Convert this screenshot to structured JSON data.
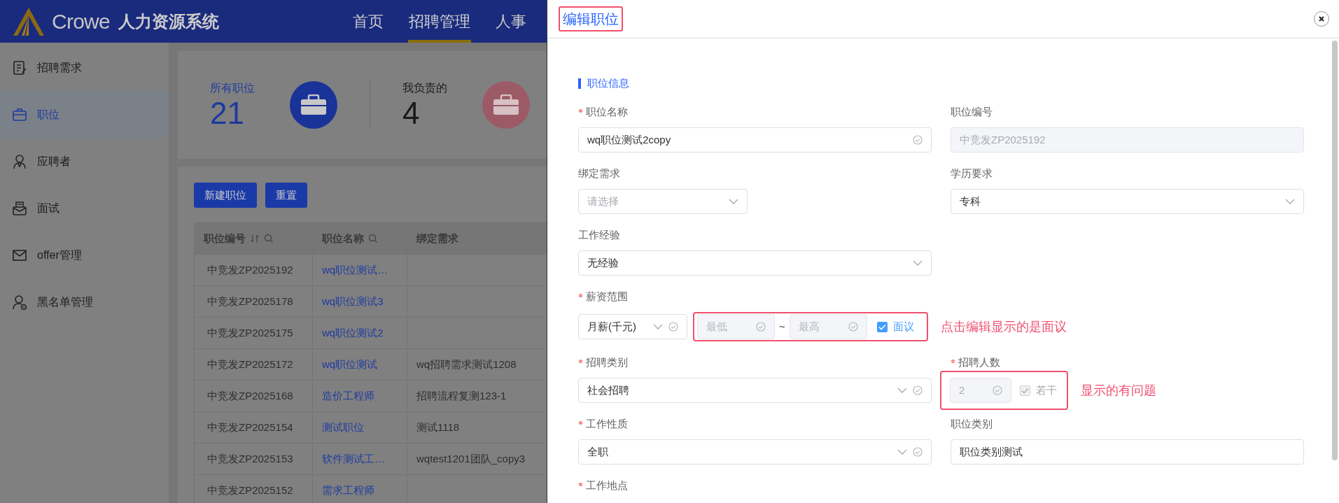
{
  "header": {
    "brand_name": "Crowe",
    "system_name": "人力资源系统",
    "nav": [
      {
        "label": "首页",
        "selected": false
      },
      {
        "label": "招聘管理",
        "selected": true
      },
      {
        "label": "人事",
        "selected": false
      }
    ]
  },
  "sidebar": {
    "items": [
      {
        "label": "招聘需求",
        "selected": false
      },
      {
        "label": "职位",
        "selected": true
      },
      {
        "label": "应聘者",
        "selected": false
      },
      {
        "label": "面试",
        "selected": false
      },
      {
        "label": "offer管理",
        "selected": false
      },
      {
        "label": "黑名单管理",
        "selected": false
      }
    ]
  },
  "stats": [
    {
      "label": "所有职位",
      "value": "21",
      "kind": "primary"
    },
    {
      "label": "我负责的",
      "value": "4",
      "kind": "secondary"
    }
  ],
  "toolbar": {
    "buttons": [
      "新建职位",
      "重置"
    ]
  },
  "table": {
    "columns": [
      {
        "label": "职位编号",
        "sortable": true,
        "searchable": true
      },
      {
        "label": "职位名称",
        "sortable": false,
        "searchable": true
      },
      {
        "label": "绑定需求",
        "sortable": false,
        "searchable": false
      }
    ],
    "rows": [
      [
        "中竞发ZP2025192",
        "wq职位测试…",
        ""
      ],
      [
        "中竞发ZP2025178",
        "wq职位测试3",
        ""
      ],
      [
        "中竞发ZP2025175",
        "wq职位测试2",
        ""
      ],
      [
        "中竞发ZP2025172",
        "wq职位测试",
        "wq招聘需求测试1208"
      ],
      [
        "中竞发ZP2025168",
        "造价工程师",
        "招聘流程复测123-1"
      ],
      [
        "中竞发ZP2025154",
        "测试职位",
        "测试1118"
      ],
      [
        "中竞发ZP2025153",
        "软件测试工…",
        "wqtest1201团队_copy3"
      ],
      [
        "中竞发ZP2025152",
        "需求工程师",
        ""
      ]
    ]
  },
  "drawer": {
    "title": "编辑职位",
    "title_highlighted": true,
    "section_title": "职位信息",
    "rows": [
      [
        {
          "label": "职位名称",
          "required": true,
          "kind": "text",
          "value": "wq职位测试2copy",
          "validated": true,
          "disabled": false
        },
        {
          "label": "职位编号",
          "required": false,
          "kind": "text",
          "value": "中竞发ZP2025192",
          "validated": false,
          "disabled": true
        }
      ],
      [
        {
          "label": "绑定需求",
          "required": false,
          "kind": "short_select",
          "placeholder": "请选择",
          "validated": false
        },
        {
          "label": "学历要求",
          "required": false,
          "kind": "select",
          "value": "专科",
          "validated": false
        }
      ],
      [
        {
          "label": "工作经验",
          "required": false,
          "kind": "select",
          "value": "无经验",
          "validated": false
        }
      ],
      [
        {
          "label": "薪资范围",
          "required": true,
          "kind": "salary",
          "period": "月薪(千元)",
          "min": {
            "placeholder": "最低",
            "disabled": true
          },
          "separator": "~",
          "max": {
            "placeholder": "最高",
            "disabled": true
          },
          "option": {
            "label": "面议",
            "checked": true,
            "disabled": false
          },
          "highlighted": true,
          "note": "点击编辑显示的是面议"
        }
      ],
      [
        {
          "label": "招聘类别",
          "required": true,
          "kind": "select",
          "value": "社会招聘",
          "validated": true
        },
        {
          "label": "招聘人数",
          "required": true,
          "kind": "headcount",
          "value": "2",
          "disabled": true,
          "option": {
            "label": "若干",
            "checked": true,
            "disabled": true
          },
          "highlighted": true,
          "note": "显示的有问题"
        }
      ],
      [
        {
          "label": "工作性质",
          "required": true,
          "kind": "select",
          "value": "全职",
          "validated": true
        },
        {
          "label": "职位类别",
          "required": false,
          "kind": "text",
          "value": "职位类别测试",
          "validated": false,
          "disabled": false
        }
      ],
      [
        {
          "label": "工作地点",
          "required": true
        }
      ]
    ]
  }
}
